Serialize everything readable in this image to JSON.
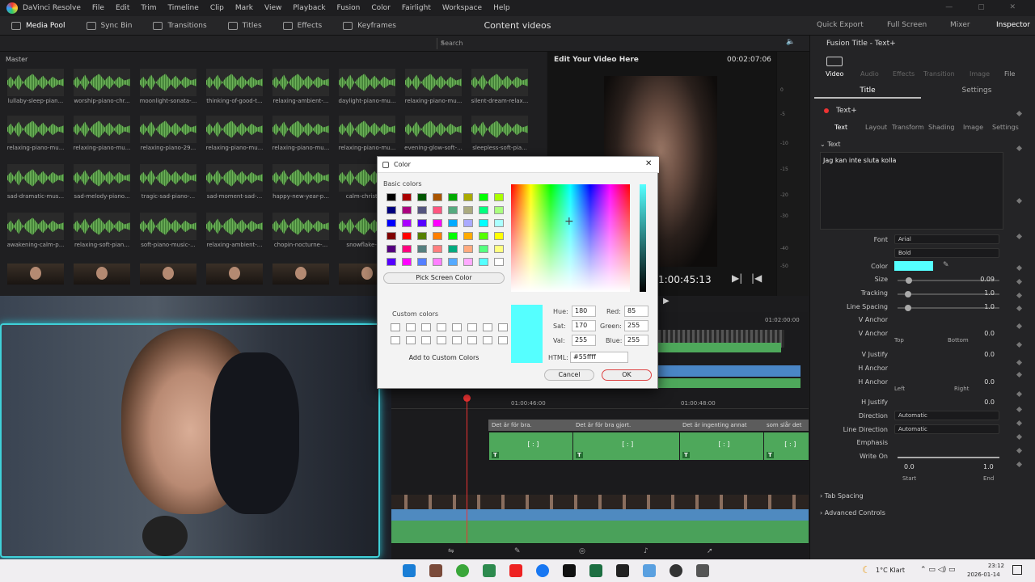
{
  "menu": [
    "DaVinci Resolve",
    "File",
    "Edit",
    "Trim",
    "Timeline",
    "Clip",
    "Mark",
    "View",
    "Playback",
    "Fusion",
    "Color",
    "Fairlight",
    "Workspace",
    "Help"
  ],
  "toolbar": {
    "media_pool": "Media Pool",
    "sync_bin": "Sync Bin",
    "transitions": "Transitions",
    "titles": "Titles",
    "effects": "Effects",
    "keyframes": "Keyframes",
    "project_title": "Content videos",
    "quick_export": "Quick Export",
    "full_screen": "Full Screen",
    "mixer": "Mixer",
    "inspector": "Inspector"
  },
  "search": {
    "placeholder": "Search"
  },
  "media": {
    "master": "Master",
    "clips": [
      "lullaby-sleep-pian...",
      "worship-piano-chr...",
      "moonlight-sonata-...",
      "thinking-of-good-t...",
      "relaxing-ambient-...",
      "daylight-piano-mu...",
      "relaxing-piano-mu...",
      "silent-dream-relax...",
      "relaxing-piano-mu...",
      "relaxing-piano-mu...",
      "relaxing-piano-29...",
      "relaxing-piano-mu...",
      "relaxing-piano-mu...",
      "relaxing-piano-mu...",
      "evening-glow-soft-...",
      "sleepless-soft-pia...",
      "sad-dramatic-mus...",
      "sad-melody-piano...",
      "tragic-sad-piano-...",
      "sad-moment-sad-...",
      "happy-new-year-p...",
      "calm-christm...",
      "",
      "",
      "awakening-calm-p...",
      "relaxing-soft-pian...",
      "soft-piano-music-...",
      "relaxing-ambient-...",
      "chopin-nocturne-...",
      "snowflake-re...",
      "",
      ""
    ]
  },
  "viewer": {
    "title": "Edit Your Video Here",
    "timecode": "00:02:07:06",
    "current": "1:00:45:13"
  },
  "meters": [
    "0",
    "-5",
    "-10",
    "-15",
    "-20",
    "-30",
    "-40",
    "-50"
  ],
  "inspector": {
    "title": "Fusion Title - Text+",
    "tabs": [
      "Video",
      "Audio",
      "Effects",
      "Transition",
      "Image",
      "File"
    ],
    "subtabs": [
      "Title",
      "Settings"
    ],
    "node": "Text+",
    "ptabs": [
      "Text",
      "Layout",
      "Transform",
      "Shading",
      "Image",
      "Settings"
    ],
    "section": "Text",
    "text_value": "Jag kan inte sluta kolla",
    "font_label": "Font",
    "font": "Arial",
    "style": "Bold",
    "color_label": "Color",
    "color_hex": "#55ffff",
    "size_label": "Size",
    "size": "0.09",
    "tracking_label": "Tracking",
    "tracking": "1.0",
    "spacing_label": "Line Spacing",
    "spacing": "1.0",
    "vanchor1": "V Anchor",
    "vanchor2": "V Anchor",
    "vanchor_val": "0.0",
    "top": "Top",
    "bottom": "Bottom",
    "vjustify": "V Justify",
    "vjustify_val": "0.0",
    "hanchor1": "H Anchor",
    "hanchor2": "H Anchor",
    "hanchor_val": "0.0",
    "left": "Left",
    "right": "Right",
    "hjustify": "H Justify",
    "hjustify_val": "0.0",
    "direction": "Direction",
    "direction_val": "Automatic",
    "line_direction": "Line Direction",
    "line_direction_val": "Automatic",
    "emphasis": "Emphasis",
    "write_on": "Write On",
    "write_start": "0.0",
    "write_end": "1.0",
    "start": "Start",
    "end": "End",
    "tab_spacing": "Tab Spacing",
    "advanced": "Advanced Controls"
  },
  "timeline": {
    "tc1": "01:00:46:00",
    "tc2": "01:00:48:00",
    "tc_ruler": "01:02:00:00",
    "titles": [
      "Det är för bra.",
      "Det är för bra gjort.",
      "Det är ingenting annat",
      "som slår det"
    ],
    "marker": "[ : ]"
  },
  "dialog": {
    "title": "Color",
    "basic": "Basic colors",
    "pick": "Pick Screen Color",
    "custom": "Custom colors",
    "add": "Add to Custom Colors",
    "hue_l": "Hue:",
    "hue": "180",
    "sat_l": "Sat:",
    "sat": "170",
    "val_l": "Val:",
    "val": "255",
    "red_l": "Red:",
    "red": "85",
    "green_l": "Green:",
    "green": "255",
    "blue_l": "Blue:",
    "blue": "255",
    "html_l": "HTML:",
    "html": "#55ffff",
    "cancel": "Cancel",
    "ok": "OK",
    "selected": "#55ffff",
    "basic_colors": [
      "#000000",
      "#aa0000",
      "#005500",
      "#aa5500",
      "#00aa00",
      "#aaaa00",
      "#00ff00",
      "#aaff00",
      "#00007f",
      "#aa007f",
      "#55557f",
      "#ff557f",
      "#55aa7f",
      "#aaaa7f",
      "#00ff7f",
      "#aaff7f",
      "#0000ff",
      "#aa00ff",
      "#5500ff",
      "#ff00ff",
      "#00aaff",
      "#aaaaff",
      "#00ffff",
      "#aaffff",
      "#7f0000",
      "#ff0000",
      "#557f00",
      "#ff7f00",
      "#00ff00",
      "#ffaa00",
      "#55ff00",
      "#ffff00",
      "#55007f",
      "#ff007f",
      "#557f7f",
      "#ff7f7f",
      "#00aa7f",
      "#ffaa7f",
      "#55ff7f",
      "#ffff7f",
      "#5500ff",
      "#ff00ff",
      "#557fff",
      "#ff7fff",
      "#55aaff",
      "#ffaaff",
      "#55ffff",
      "#ffffff"
    ]
  },
  "tray": {
    "weather": "1°C  Klart",
    "time": "23:12",
    "date": "2026-01-14"
  }
}
